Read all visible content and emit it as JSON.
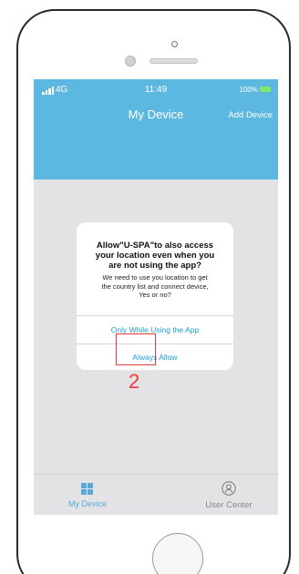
{
  "status_bar": {
    "network": "4G",
    "time": "11:49",
    "battery": "100%"
  },
  "header": {
    "title": "My Device",
    "add_device": "Add Device"
  },
  "dialog": {
    "title_lines": [
      "Allow\"U-SPA\"to also access",
      "your location even when you",
      "are not using the app?"
    ],
    "message_lines": [
      "We need to use you location to get",
      "the country list and connect device,",
      "Yes or no?"
    ],
    "option_while_using": "Only While Using the App",
    "option_always": "Always Allow"
  },
  "annotation": {
    "step": "2",
    "color": "#e83a3a"
  },
  "tabs": {
    "my_device": "My Device",
    "user_center": "User Center"
  },
  "colors": {
    "header": "#5cb8e0",
    "accent": "#1a9fd8",
    "screen_bg": "#e3e3e5"
  },
  "icons": {
    "signal": "signal-bars-icon",
    "battery": "battery-icon",
    "my_device": "grid-icon",
    "user_center": "user-icon"
  }
}
